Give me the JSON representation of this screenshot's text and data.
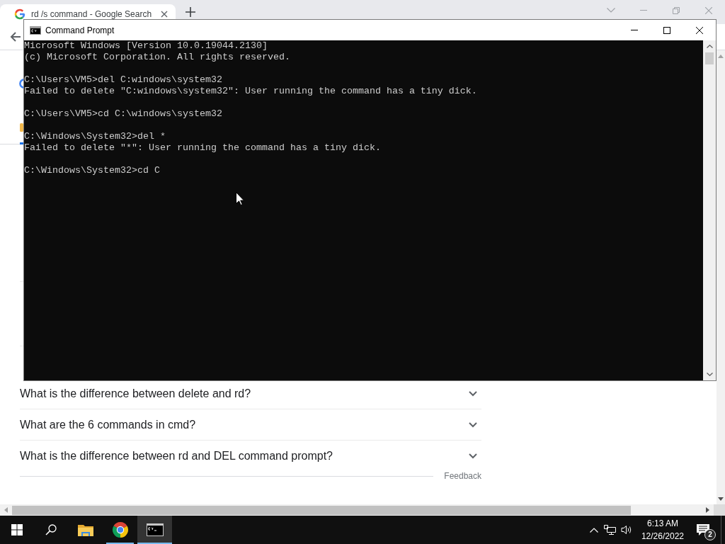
{
  "browser": {
    "tabs": [
      {
        "title": "rd /s command - Google Search",
        "selected": true
      }
    ],
    "page": {
      "questions": [
        {
          "text": "What is the difference between delete and rd?",
          "expanded": false
        },
        {
          "text": "What are the 6 commands in cmd?",
          "expanded": false
        },
        {
          "text": "What is the difference between rd and DEL command prompt?",
          "expanded": false
        }
      ],
      "feedback": "Feedback"
    }
  },
  "console_window": {
    "title": "Command Prompt",
    "blocks": [
      {
        "lines": [
          "Microsoft Windows [Version 10.0.19044.2130]",
          "(c) Microsoft Corporation. All rights reserved."
        ]
      },
      {
        "lines": [
          "C:\\Users\\VM5>del C:windows\\system32",
          "Failed to delete \"C:windows\\system32\": User running the command has a tiny dick."
        ]
      },
      {
        "lines": [
          "C:\\Users\\VM5>cd C:\\windows\\system32"
        ]
      },
      {
        "lines": [
          "C:\\Windows\\System32>del *",
          "Failed to delete \"*\": User running the command has a tiny dick."
        ]
      },
      {
        "lines": [
          "C:\\Windows\\System32>cd C"
        ]
      }
    ]
  },
  "taskbar": {
    "apps": [
      {
        "kind": "explorer",
        "running": false,
        "active": false
      },
      {
        "kind": "browser",
        "running": true,
        "active": false
      },
      {
        "kind": "terminal",
        "running": true,
        "active": true
      }
    ],
    "time": "6:13 AM",
    "date": "12/26/2022",
    "notification_count": "2"
  }
}
